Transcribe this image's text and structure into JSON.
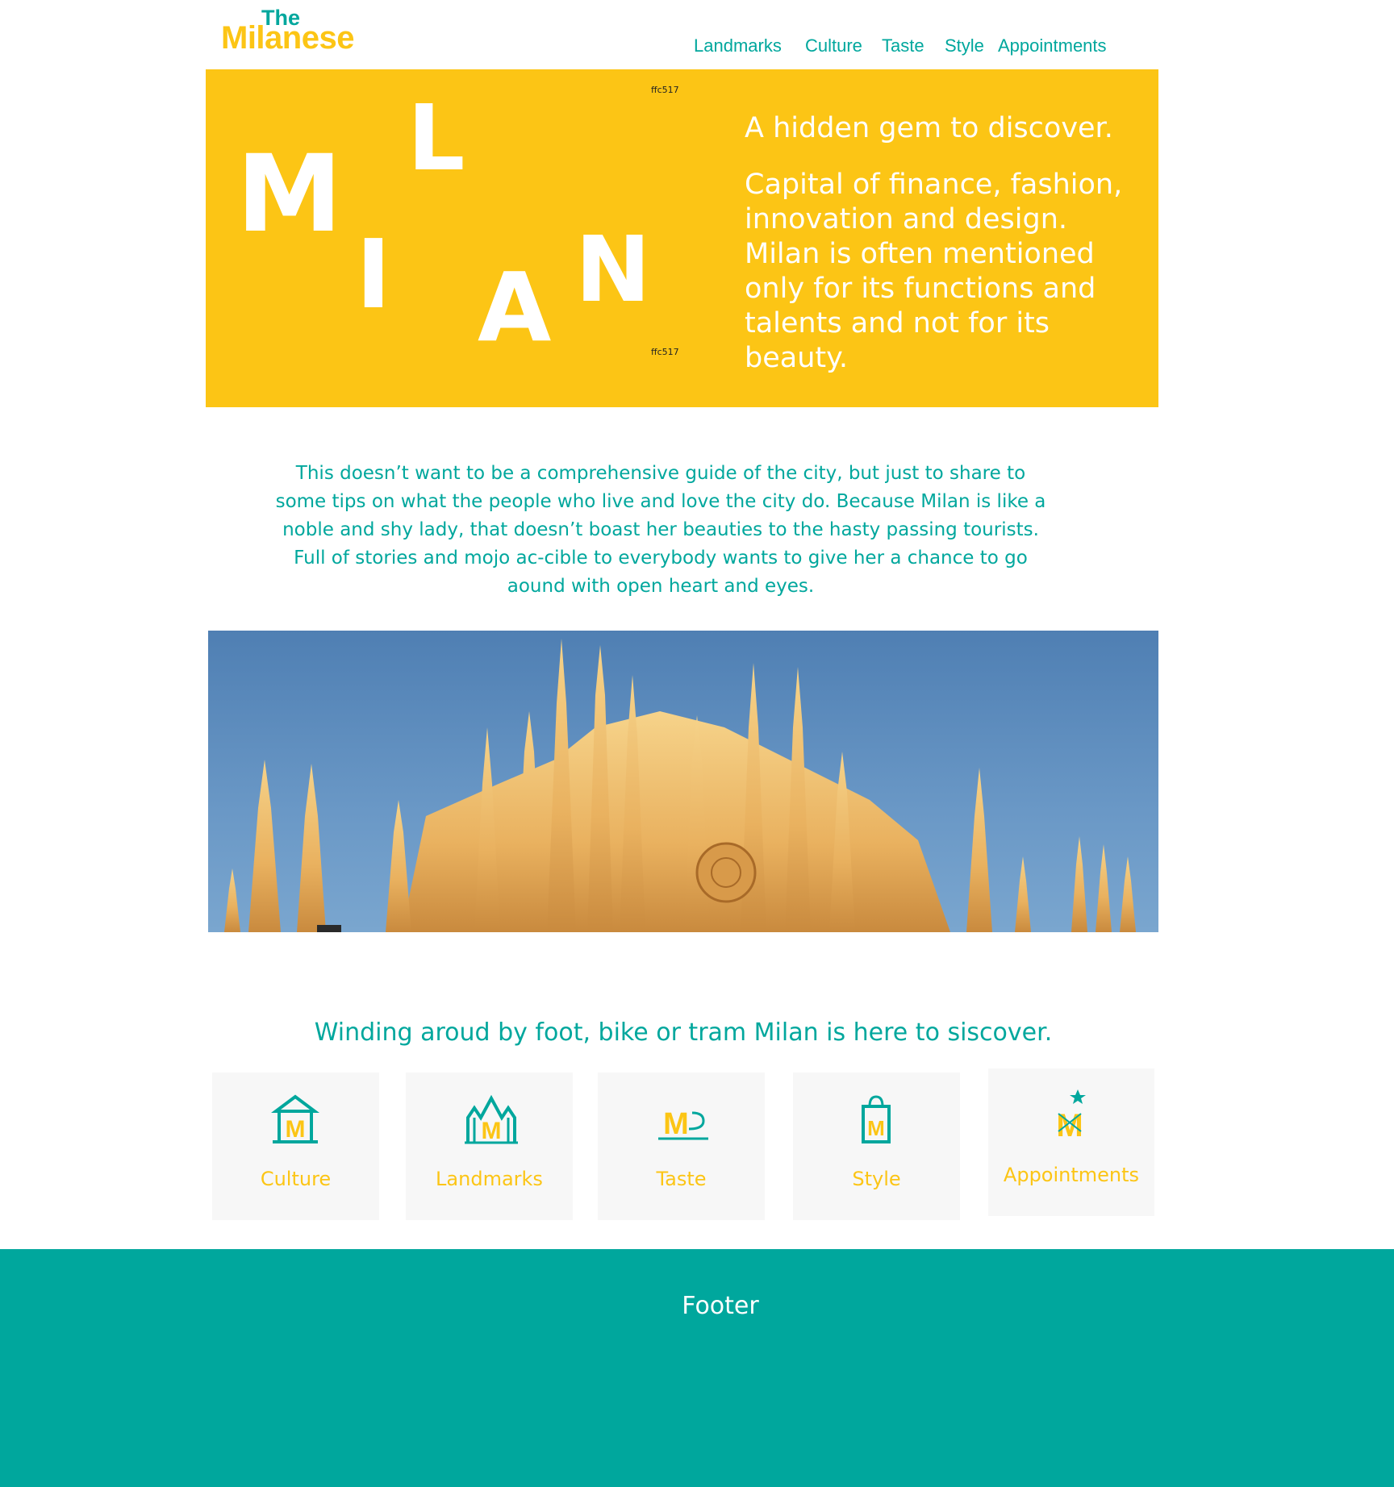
{
  "colors": {
    "brand_yellow": "#fcc515",
    "brand_teal": "#00a79d",
    "card_bg": "#f7f7f7",
    "white": "#ffffff"
  },
  "logo": {
    "line1": "The",
    "line2": "Milanese"
  },
  "nav": {
    "items": [
      "Landmarks",
      "Culture",
      "Taste",
      "Style",
      "Appointments"
    ]
  },
  "hero": {
    "letters": [
      "M",
      "L",
      "I",
      "A",
      "N"
    ],
    "hex_note_top": "ffc517",
    "hex_note_bottom": "ffc517",
    "headline": "A hidden gem to discover.",
    "body": "Capital of finance, fashion, innovation and design. Milan is often mentioned only for its functions and talents and not for its beauty."
  },
  "intro": {
    "text": "This doesn’t want to be a comprehensive guide of the city, but just to share to some tips on what the people who live and love the city do. Because Milan is like a noble and shy lady, that doesn’t boast her beauties to the hasty passing tourists. Full of stories and mojo ac-cible to everybody wants to give her a chance to go aound with open heart and eyes."
  },
  "photo": {
    "icon": "cathedral-photo"
  },
  "tagline": {
    "text": "Winding aroud by foot, bike or tram Milan is here to siscover."
  },
  "cards": [
    {
      "label": "Culture",
      "icon": "museum-icon"
    },
    {
      "label": "Landmarks",
      "icon": "cathedral-icon"
    },
    {
      "label": "Taste",
      "icon": "coffee-icon"
    },
    {
      "label": "Style",
      "icon": "shopping-bag-icon"
    },
    {
      "label": "Appointments",
      "icon": "star-figure-icon"
    }
  ],
  "footer": {
    "label": "Footer"
  }
}
